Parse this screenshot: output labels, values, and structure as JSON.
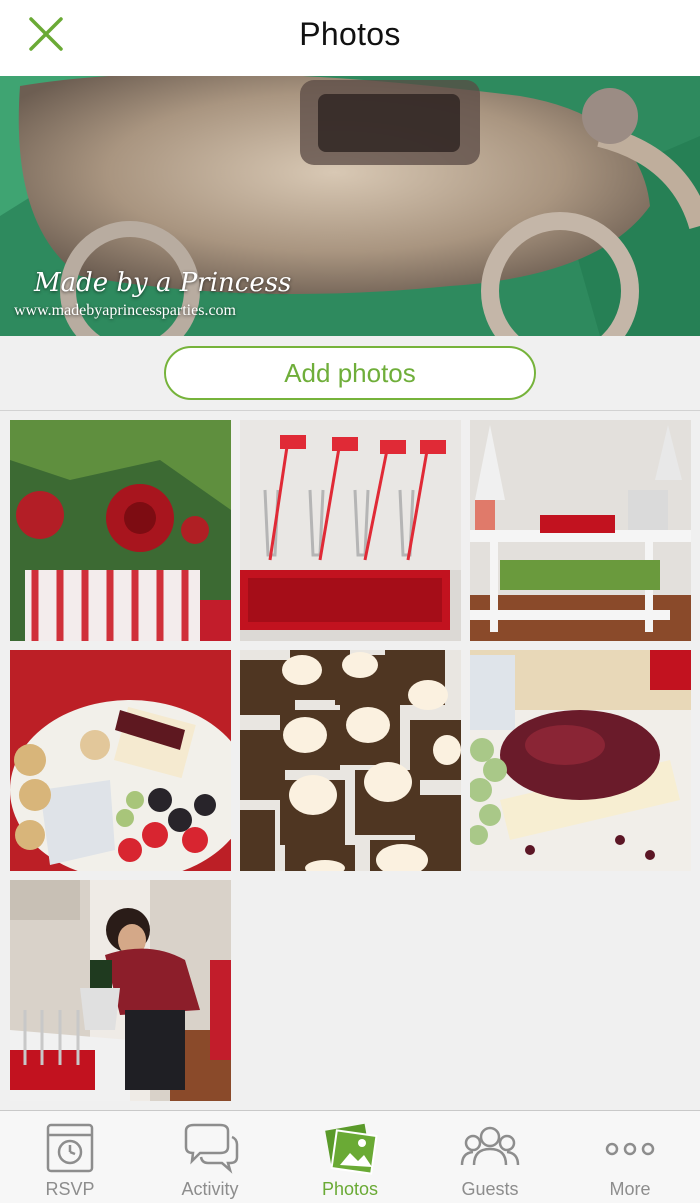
{
  "header": {
    "title": "Photos"
  },
  "hero": {
    "watermark_script": "Made by a Princess",
    "watermark_url": "www.madebyaprincessparties.com"
  },
  "actions": {
    "add_photos": "Add photos"
  },
  "photos": [
    {
      "subject": "roses-candy-cane-centerpiece"
    },
    {
      "subject": "champagne-glasses-red-tray"
    },
    {
      "subject": "merry-bar-cart"
    },
    {
      "subject": "cheese-board"
    },
    {
      "subject": "frosted-brownies"
    },
    {
      "subject": "brie-cranberry"
    },
    {
      "subject": "woman-pouring-champagne"
    }
  ],
  "tabs": [
    {
      "label": "RSVP",
      "icon": "calendar-clock-icon"
    },
    {
      "label": "Activity",
      "icon": "chat-bubbles-icon"
    },
    {
      "label": "Photos",
      "icon": "photos-icon",
      "active": true
    },
    {
      "label": "Guests",
      "icon": "guests-icon"
    },
    {
      "label": "More",
      "icon": "more-dots-icon"
    }
  ],
  "colors": {
    "accent": "#6aaa35",
    "inactive": "#8d8d8d"
  }
}
